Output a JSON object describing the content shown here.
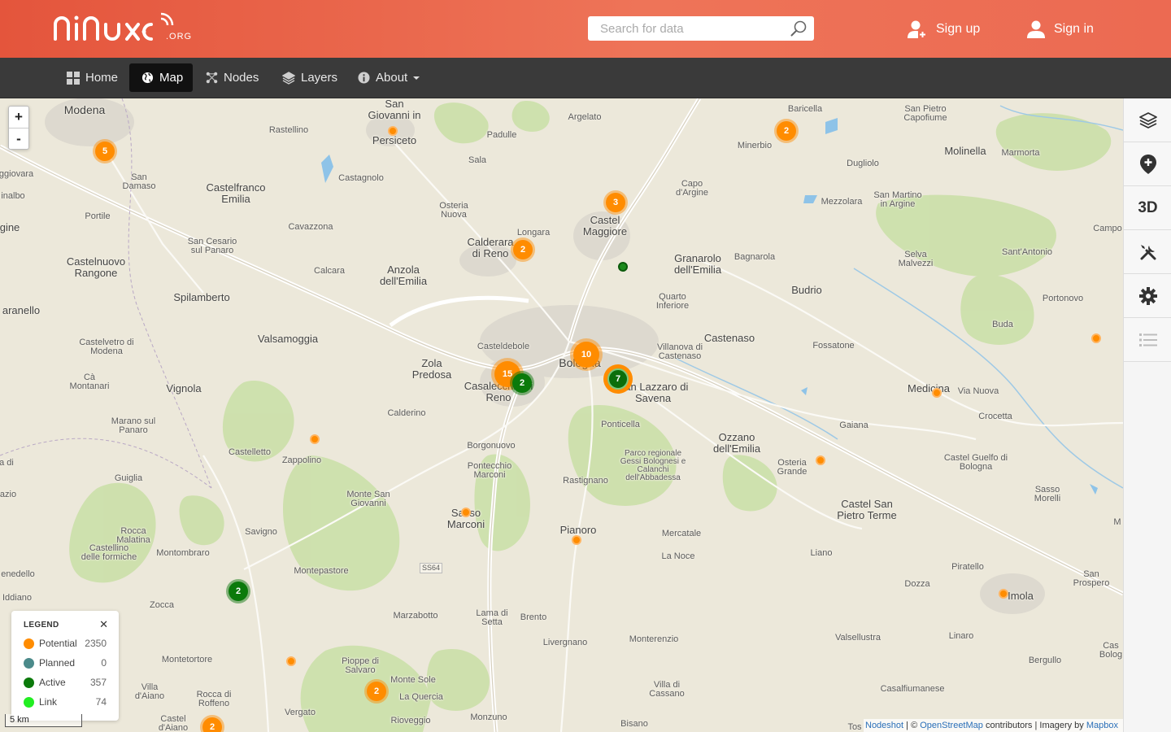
{
  "header": {
    "logo_alt": "ninux.org",
    "search_placeholder": "Search for data",
    "signup_label": "Sign up",
    "signin_label": "Sign in"
  },
  "nav": [
    {
      "label": "Home",
      "icon": "grid-icon",
      "active": false
    },
    {
      "label": "Map",
      "icon": "globe-icon",
      "active": true
    },
    {
      "label": "Nodes",
      "icon": "nodes-icon",
      "active": false
    },
    {
      "label": "Layers",
      "icon": "layers-icon",
      "active": false
    },
    {
      "label": "About",
      "icon": "info-icon",
      "active": false,
      "dropdown": true
    }
  ],
  "map": {
    "zoom_in": "+",
    "zoom_out": "-",
    "scale_label": "5 km",
    "attribution": {
      "nodeshot": "Nodeshot",
      "sep1": " | © ",
      "osm": "OpenStreetMap",
      "contrib": " contributors | Imagery by ",
      "mapbox": "Mapbox"
    },
    "places": {
      "modena": "Modena",
      "san_giovanni": "San Giovanni in",
      "persiceto": "Persiceto",
      "argelato": "Argelato",
      "baricella": "Baricella",
      "san_pietro_capofiume": "San Pietro Capofiume",
      "rastellino": "Rastellino",
      "padulle": "Padulle",
      "minerbio": "Minerbio",
      "molinella": "Molinella",
      "marmorta": "Marmorta",
      "sala": "Sala",
      "dugliolo": "Dugliolo",
      "giovara": "ggiovara",
      "san_damaso": "San Damaso",
      "castelfranco": "Castelfranco Emilia",
      "castagnolo": "Castagnolo",
      "capo_argine": "Capo d'Argine",
      "inalbo": "inalbo",
      "osteria_nuova": "Osteria Nuova",
      "mezzolara": "Mezzolara",
      "san_martino": "San Martino in Argine",
      "castel_maggiore": "Castel Maggiore",
      "portile": "Portile",
      "gine": "gine",
      "cavazzona": "Cavazzona",
      "longara": "Longara",
      "campo": "Campo",
      "san_cesario": "San Cesario sul Panaro",
      "calderara": "Calderara di Reno",
      "granarolo": "Granarolo dell'Emilia",
      "bagnarola": "Bagnarola",
      "selva_malvezzi": "Selva Malvezzi",
      "sant_antonio": "Sant'Antonio",
      "castelnuovo": "Castelnuovo Rangone",
      "calcara": "Calcara",
      "anzola": "Anzola dell'Emilia",
      "budrio": "Budrio",
      "quarto": "Quarto Inferiore",
      "portonovo": "Portonovo",
      "spilamberto": "Spilamberto",
      "maranello": "aranello",
      "buda": "Buda",
      "valsamoggia": "Valsamoggia",
      "castenaso": "Castenaso",
      "casteldebole": "Casteldebole",
      "villanova": "Villanova di Castenaso",
      "fossatone": "Fossatone",
      "castelvetro": "Castelvetro di Modena",
      "zola": "Zola Predosa",
      "bologna": "Bologna",
      "ca_montanari": "Cà Montanari",
      "vignola": "Vignola",
      "casalecchio": "Casalecchio di Reno",
      "san_lazzaro": "San Lazzaro di Savena",
      "medicina": "Medicina",
      "via_nuova": "Via Nuova",
      "calderino": "Calderino",
      "crocetta": "Crocetta",
      "marano": "Marano sul Panaro",
      "ponticella": "Ponticella",
      "gaiana": "Gaiana",
      "ozzano": "Ozzano dell'Emilia",
      "borgonuovo": "Borgonuovo",
      "castelletto": "Castelletto",
      "zappolino": "Zappolino",
      "parco": "Parco regionale Gessi Bolognesi e Calanchi dell'Abbadessa",
      "osteria_grande": "Osteria Grande",
      "castel_guelfo": "Castel Guelfo di Bologna",
      "a_di": "a di",
      "pontecchio": "Pontecchio Marconi",
      "guiglia": "Guiglia",
      "rastignano": "Rastignano",
      "azio": "azio",
      "sasso_morelli": "Sasso Morelli",
      "monte_san_giovanni": "Monte San Giovanni",
      "castel_san_pietro": "Castel San Pietro Terme",
      "sasso_marconi": "Sasso Marconi",
      "m": "M",
      "rocca_malatina": "Rocca Malatina",
      "savigno": "Savigno",
      "pianoro": "Pianoro",
      "mercatale": "Mercatale",
      "castellino": "Castellino delle formiche",
      "montombraro": "Montombraro",
      "liano": "Liano",
      "la_noce": "La Noce",
      "piratello": "Piratello",
      "ss64": "SS64",
      "montepastore": "Montepastore",
      "san_prospero": "San Prospero",
      "enedello": "enedello",
      "dozza": "Dozza",
      "imola": "Imola",
      "iddiano": "Iddiano",
      "zocca": "Zocca",
      "lama_di_setta": "Lama di Setta",
      "marzabotto": "Marzabotto",
      "brento": "Brento",
      "valsellustra": "Valsellustra",
      "linaro": "Linaro",
      "cas_bolog": "Cas Bolog",
      "livergnano": "Livergnano",
      "monterenzio": "Monterenzio",
      "montetortore": "Montetortore",
      "pioppe": "Pioppe di Salvaro",
      "bergullo": "Bergullo",
      "monte_sole": "Monte Sole",
      "villa_d_aiano": "Villa d'Aiano",
      "villa_di_cassano": "Villa di Cassano",
      "la_quercia": "La Quercia",
      "casalfiumanese": "Casalfiumanese",
      "rocca_di_roffeno": "Rocca di Roffeno",
      "vergato": "Vergato",
      "castel_d_aiano": "Castel d'Aiano",
      "rioveggio": "Rioveggio",
      "monzuno": "Monzuno",
      "bisano": "Bisano",
      "tos": "Tos"
    },
    "clusters": [
      {
        "count": "5",
        "type": "orange"
      },
      {
        "count": "2",
        "type": "orange"
      },
      {
        "count": "3",
        "type": "orange"
      },
      {
        "count": "2",
        "type": "orange"
      },
      {
        "count": "10",
        "type": "orange"
      },
      {
        "count": "15",
        "type": "orange"
      },
      {
        "count": "2",
        "type": "green"
      },
      {
        "count": "7",
        "type": "mixed"
      },
      {
        "count": "2",
        "type": "green"
      },
      {
        "count": "2",
        "type": "orange"
      },
      {
        "count": "2",
        "type": "orange"
      }
    ]
  },
  "legend": {
    "title": "LEGEND",
    "close": "✕",
    "items": [
      {
        "label": "Potential",
        "count": "2350",
        "color": "#ff8c00"
      },
      {
        "label": "Planned",
        "count": "0",
        "color": "#4b8a8a"
      },
      {
        "label": "Active",
        "count": "357",
        "color": "#0b7a0b"
      },
      {
        "label": "Link",
        "count": "74",
        "color": "#22ee22"
      }
    ]
  },
  "tools": [
    {
      "icon": "layers-icon"
    },
    {
      "icon": "add-marker-icon"
    },
    {
      "label": "3D"
    },
    {
      "icon": "tools-icon"
    },
    {
      "icon": "gear-icon"
    },
    {
      "icon": "list-icon"
    }
  ],
  "colors": {
    "brand": "#e85d44",
    "nav": "#3a3a3a",
    "potential": "#ff8c00",
    "active": "#0b7a0b"
  }
}
